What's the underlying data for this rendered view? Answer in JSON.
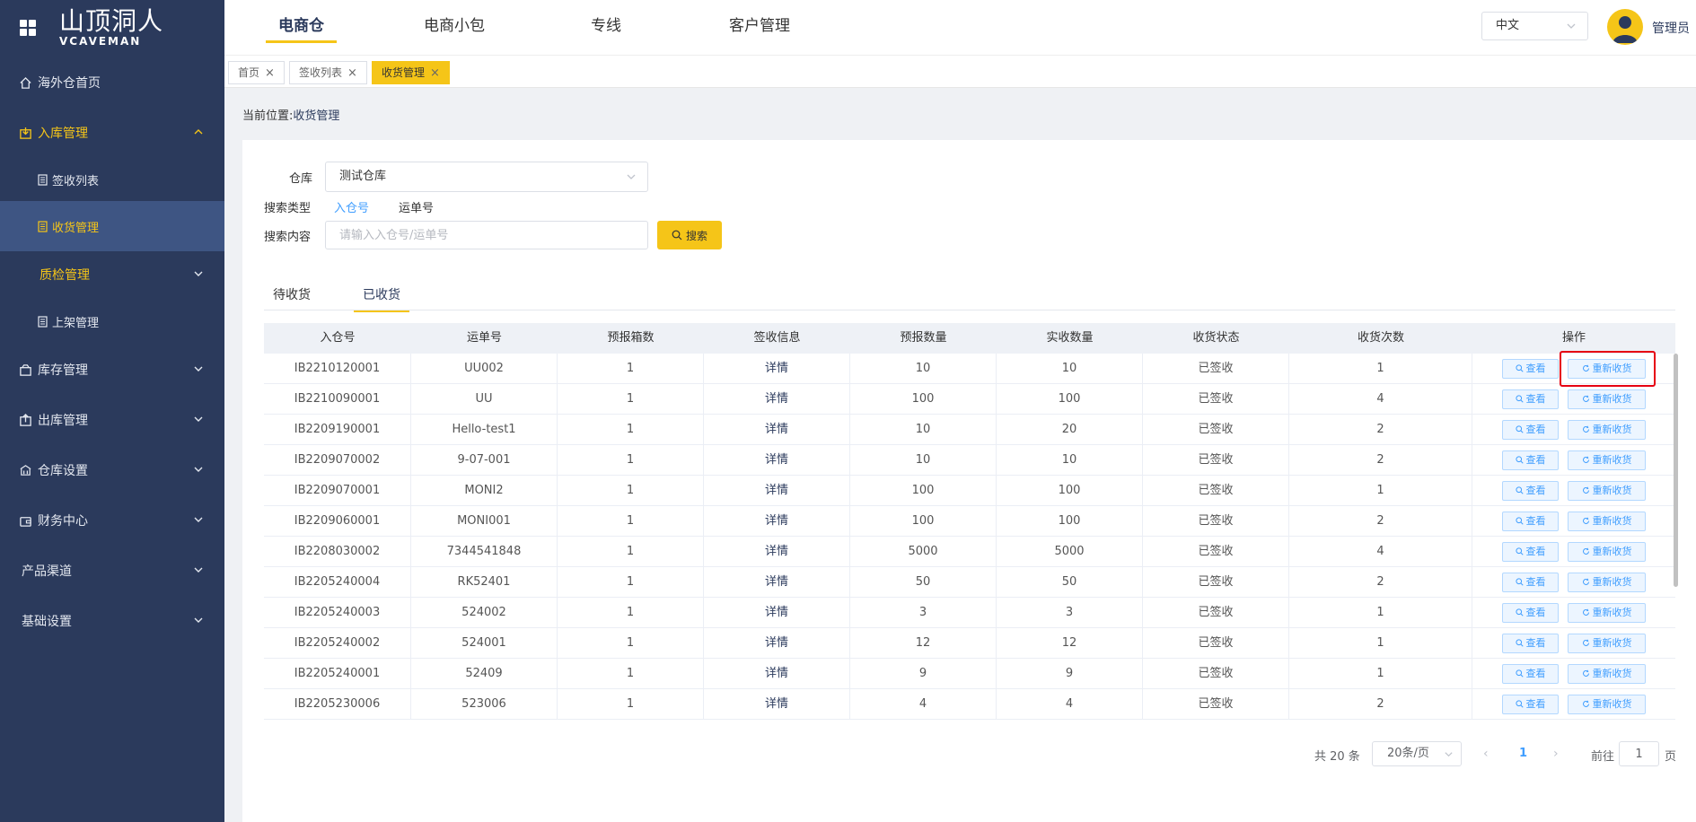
{
  "app": {
    "logo_cn": "山顶洞人",
    "logo_en": "VCAVEMAN"
  },
  "sidebar": {
    "items": [
      {
        "label": "海外仓首页"
      },
      {
        "label": "入库管理"
      },
      {
        "label": "签收列表"
      },
      {
        "label": "收货管理"
      },
      {
        "label": "质检管理"
      },
      {
        "label": "上架管理"
      },
      {
        "label": "库存管理"
      },
      {
        "label": "出库管理"
      },
      {
        "label": "仓库设置"
      },
      {
        "label": "财务中心"
      },
      {
        "label": "产品渠道"
      },
      {
        "label": "基础设置"
      }
    ]
  },
  "topnav": {
    "tabs": [
      {
        "label": "电商仓"
      },
      {
        "label": "电商小包"
      },
      {
        "label": "专线"
      },
      {
        "label": "客户管理"
      }
    ],
    "language": "中文",
    "user": "管理员"
  },
  "page_tabs": [
    {
      "label": "首页"
    },
    {
      "label": "签收列表"
    },
    {
      "label": "收货管理"
    }
  ],
  "breadcrumb": {
    "prefix": "当前位置:",
    "current": "收货管理"
  },
  "filters": {
    "warehouse_label": "仓库",
    "warehouse_value": "测试仓库",
    "search_type_label": "搜索类型",
    "search_types": [
      "入仓号",
      "运单号"
    ],
    "search_content_label": "搜索内容",
    "search_placeholder": "请输入入仓号/运单号",
    "search_button": "搜索"
  },
  "inner_tabs": [
    "待收货",
    "已收货"
  ],
  "table": {
    "columns": [
      "入仓号",
      "运单号",
      "预报箱数",
      "签收信息",
      "预报数量",
      "实收数量",
      "收货状态",
      "收货次数",
      "操作"
    ],
    "detail_label": "详情",
    "view_label": "查看",
    "rereceive_label": "重新收货",
    "rows": [
      {
        "inbound": "IB2210120001",
        "waybill": "UU002",
        "boxes": "1",
        "forecast": "10",
        "received": "10",
        "status": "已签收",
        "times": "1"
      },
      {
        "inbound": "IB2210090001",
        "waybill": "UU",
        "boxes": "1",
        "forecast": "100",
        "received": "100",
        "status": "已签收",
        "times": "4"
      },
      {
        "inbound": "IB2209190001",
        "waybill": "Hello-test1",
        "boxes": "1",
        "forecast": "10",
        "received": "20",
        "status": "已签收",
        "times": "2"
      },
      {
        "inbound": "IB2209070002",
        "waybill": "9-07-001",
        "boxes": "1",
        "forecast": "10",
        "received": "10",
        "status": "已签收",
        "times": "2"
      },
      {
        "inbound": "IB2209070001",
        "waybill": "MONI2",
        "boxes": "1",
        "forecast": "100",
        "received": "100",
        "status": "已签收",
        "times": "1"
      },
      {
        "inbound": "IB2209060001",
        "waybill": "MONI001",
        "boxes": "1",
        "forecast": "100",
        "received": "100",
        "status": "已签收",
        "times": "2"
      },
      {
        "inbound": "IB2208030002",
        "waybill": "7344541848",
        "boxes": "1",
        "forecast": "5000",
        "received": "5000",
        "status": "已签收",
        "times": "4"
      },
      {
        "inbound": "IB2205240004",
        "waybill": "RK52401",
        "boxes": "1",
        "forecast": "50",
        "received": "50",
        "status": "已签收",
        "times": "2"
      },
      {
        "inbound": "IB2205240003",
        "waybill": "524002",
        "boxes": "1",
        "forecast": "3",
        "received": "3",
        "status": "已签收",
        "times": "1"
      },
      {
        "inbound": "IB2205240002",
        "waybill": "524001",
        "boxes": "1",
        "forecast": "12",
        "received": "12",
        "status": "已签收",
        "times": "1"
      },
      {
        "inbound": "IB2205240001",
        "waybill": "52409",
        "boxes": "1",
        "forecast": "9",
        "received": "9",
        "status": "已签收",
        "times": "1"
      },
      {
        "inbound": "IB2205230006",
        "waybill": "523006",
        "boxes": "1",
        "forecast": "4",
        "received": "4",
        "status": "已签收",
        "times": "2"
      }
    ]
  },
  "pagination": {
    "total": "共 20 条",
    "page_size": "20条/页",
    "current_page": "1",
    "goto_label": "前往",
    "goto_value": "1",
    "goto_suffix": "页"
  },
  "colors": {
    "sidebar_bg": "#2b3a5c",
    "accent": "#f5c518",
    "link": "#409eff",
    "highlight": "#e60012"
  }
}
